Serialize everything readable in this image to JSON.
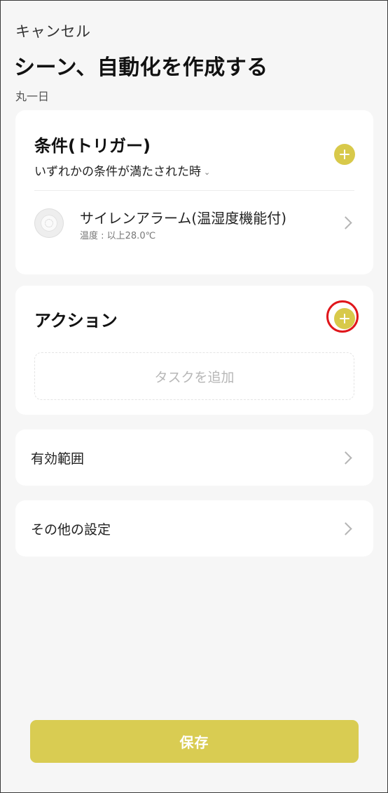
{
  "header": {
    "cancel_label": "キャンセル",
    "title": "シーン、自動化を作成する",
    "schedule": "丸一日"
  },
  "conditions": {
    "title": "条件(トリガー)",
    "trigger_mode": "いずれかの条件が満たされた時",
    "add_icon": "plus-circle-icon",
    "items": [
      {
        "device_name": "サイレンアラーム(温湿度機能付)",
        "detail": "温度 : 以上28.0℃",
        "icon": "siren-device-icon"
      }
    ]
  },
  "actions": {
    "title": "アクション",
    "add_icon": "plus-circle-icon",
    "add_task_label": "タスクを追加"
  },
  "settings_rows": [
    {
      "label": "有効範囲"
    },
    {
      "label": "その他の設定"
    }
  ],
  "footer": {
    "save_label": "保存"
  },
  "colors": {
    "accent": "#d8c94a",
    "highlight": "#e0161b",
    "background": "#f6f6f6"
  }
}
